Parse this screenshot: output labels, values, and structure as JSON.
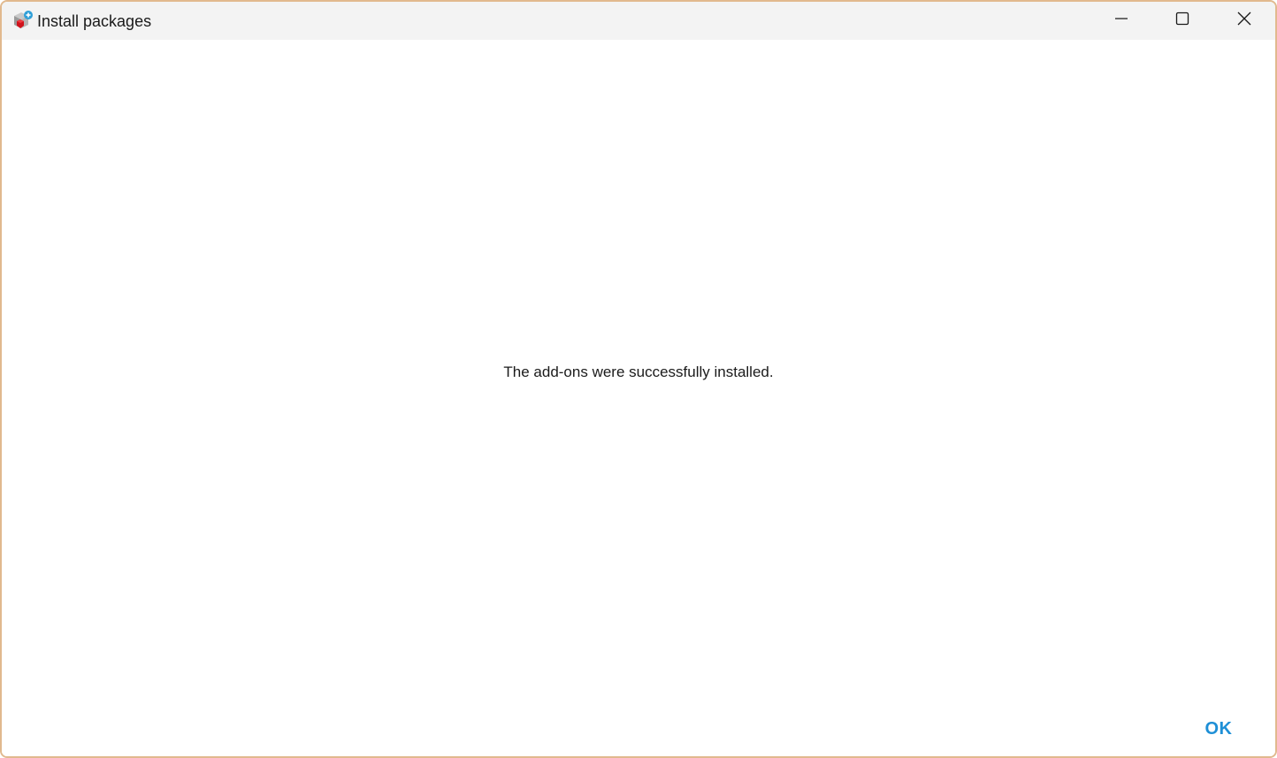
{
  "window": {
    "title": "Install packages",
    "icon": "r-package-icon",
    "controls": [
      "minimize-icon",
      "maximize-icon",
      "close-icon"
    ]
  },
  "dialog": {
    "message": "The add-ons were successfully installed.",
    "ok_label": "OK"
  },
  "colors": {
    "window_border": "#e1b98e",
    "titlebar_bg": "#f3f3f3",
    "accent": "#1e8fd6"
  }
}
